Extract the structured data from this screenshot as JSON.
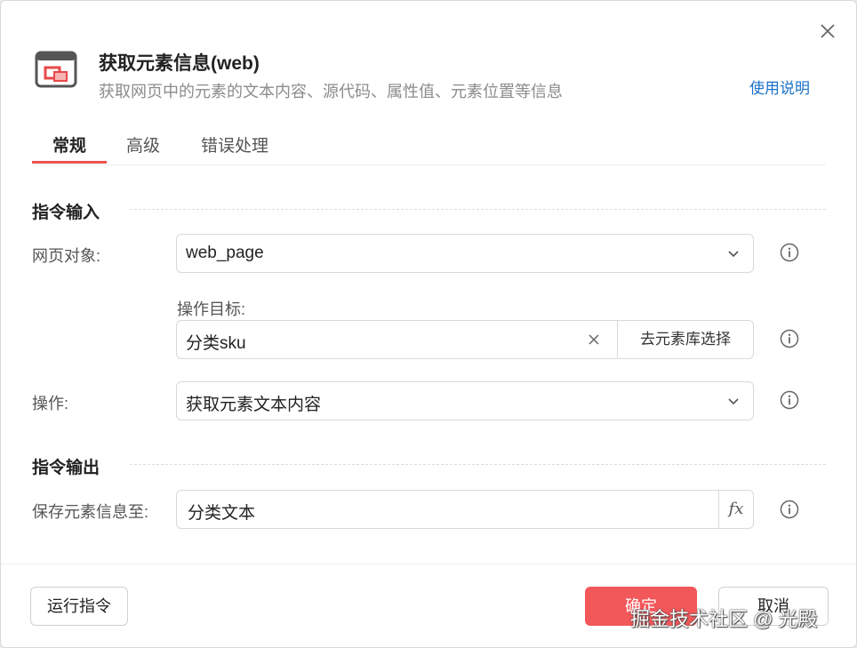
{
  "dialog": {
    "title": "获取元素信息(web)",
    "subtitle": "获取网页中的元素的文本内容、源代码、属性值、元素位置等信息",
    "help_link": "使用说明",
    "header_icon": "browser-element-icon",
    "close_icon": "close-icon"
  },
  "tabs": [
    {
      "label": "常规",
      "active": true
    },
    {
      "label": "高级",
      "active": false
    },
    {
      "label": "错误处理",
      "active": false
    }
  ],
  "input_section": {
    "title": "指令输入",
    "web_page": {
      "label": "网页对象:",
      "value": "web_page"
    },
    "target": {
      "label": "操作目标:",
      "value": "分类sku",
      "library_button": "去元素库选择"
    },
    "operation": {
      "label": "操作:",
      "value": "获取元素文本内容"
    }
  },
  "output_section": {
    "title": "指令输出",
    "save_to": {
      "label": "保存元素信息至:",
      "value": "分类文本",
      "fx_label": "fx"
    }
  },
  "footer": {
    "run_button": "运行指令",
    "ok_button": "确定",
    "cancel_button": "取消"
  },
  "watermark": "掘金技术社区 @ 光殿",
  "colors": {
    "accent": "#e9534f",
    "primary_button": "#f2575a",
    "link": "#1a73c9"
  }
}
